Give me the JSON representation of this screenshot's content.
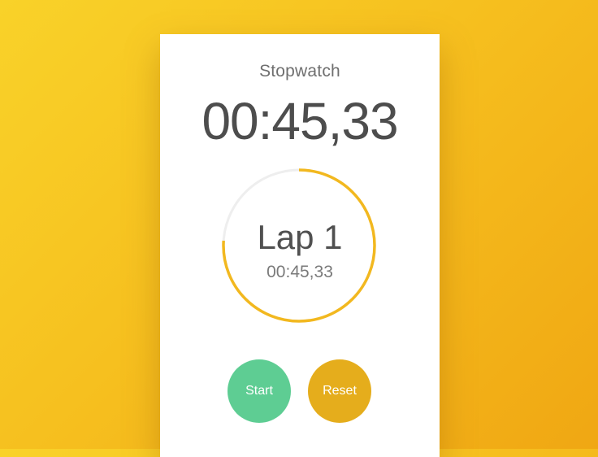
{
  "app": {
    "title": "Stopwatch"
  },
  "timer": {
    "elapsed": "00:45,33"
  },
  "lap": {
    "label": "Lap 1",
    "time": "00:45,33",
    "progress_fraction": 0.76
  },
  "buttons": {
    "start_label": "Start",
    "reset_label": "Reset"
  },
  "colors": {
    "background_start": "#f9d229",
    "background_end": "#f0a713",
    "ring_progress": "#f2b81f",
    "ring_track": "#eeeeee",
    "start_button": "#5ecd93",
    "reset_button": "#e5ad1c"
  }
}
